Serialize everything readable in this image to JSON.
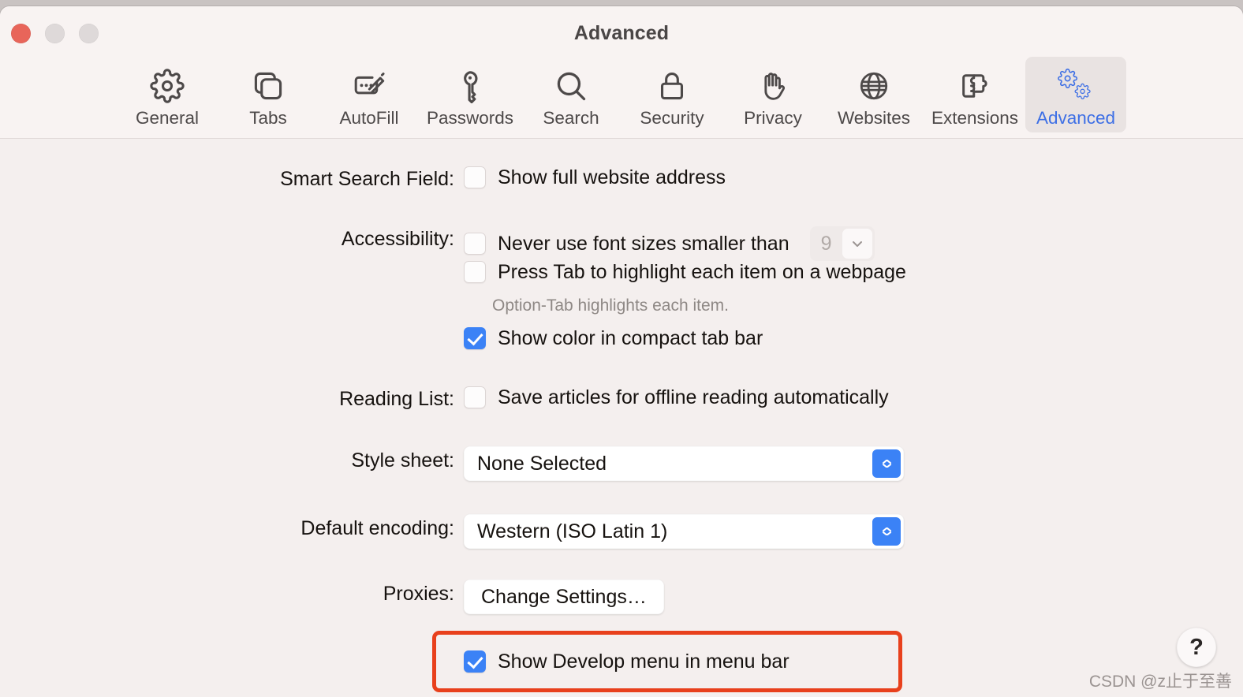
{
  "window": {
    "title": "Advanced",
    "traffic_lights": [
      "close-button",
      "minimize-button",
      "maximize-button"
    ],
    "accent_blue": "#3b82f6",
    "toolbar_selected_blue": "#3d6fe5",
    "background": "#f4efee",
    "annotation_color": "#e8401c"
  },
  "toolbar": {
    "items": [
      {
        "label": "General",
        "icon": "gear-icon",
        "selected": false
      },
      {
        "label": "Tabs",
        "icon": "tabs-icon",
        "selected": false
      },
      {
        "label": "AutoFill",
        "icon": "autofill-icon",
        "selected": false
      },
      {
        "label": "Passwords",
        "icon": "key-icon",
        "selected": false
      },
      {
        "label": "Search",
        "icon": "magnifier-icon",
        "selected": false
      },
      {
        "label": "Security",
        "icon": "lock-icon",
        "selected": false
      },
      {
        "label": "Privacy",
        "icon": "hand-icon",
        "selected": false
      },
      {
        "label": "Websites",
        "icon": "globe-icon",
        "selected": false
      },
      {
        "label": "Extensions",
        "icon": "puzzle-icon",
        "selected": false
      },
      {
        "label": "Advanced",
        "icon": "double-gear-icon",
        "selected": true
      }
    ]
  },
  "settings": {
    "smart_search_field": {
      "label": "Smart Search Field:",
      "checkbox_label": "Show full website address",
      "checked": false
    },
    "accessibility": {
      "label": "Accessibility:",
      "font_size_row": {
        "checkbox_label": "Never use font sizes smaller than",
        "checked": false,
        "value": "9",
        "stepper_icon": "chevron-down-icon",
        "disabled": true
      },
      "tab_highlight_row": {
        "checkbox_label": "Press Tab to highlight each item on a webpage",
        "checked": false
      },
      "hint": "Option-Tab highlights each item.",
      "compact_tab_row": {
        "checkbox_label": "Show color in compact tab bar",
        "checked": true
      }
    },
    "reading_list": {
      "label": "Reading List:",
      "checkbox_label": "Save articles for offline reading automatically",
      "checked": false
    },
    "style_sheet": {
      "label": "Style sheet:",
      "value": "None Selected",
      "arrows_icon": "updown-chevrons-icon"
    },
    "default_encoding": {
      "label": "Default encoding:",
      "value": "Western (ISO Latin 1)",
      "arrows_icon": "updown-chevrons-icon"
    },
    "proxies": {
      "label": "Proxies:",
      "button_label": "Change Settings…"
    },
    "develop_menu": {
      "checkbox_label": "Show Develop menu in menu bar",
      "checked": true,
      "highlighted": true
    }
  },
  "help": {
    "label": "?",
    "icon": "question-mark-icon"
  },
  "watermark": {
    "text": "CSDN @z止于至善"
  }
}
